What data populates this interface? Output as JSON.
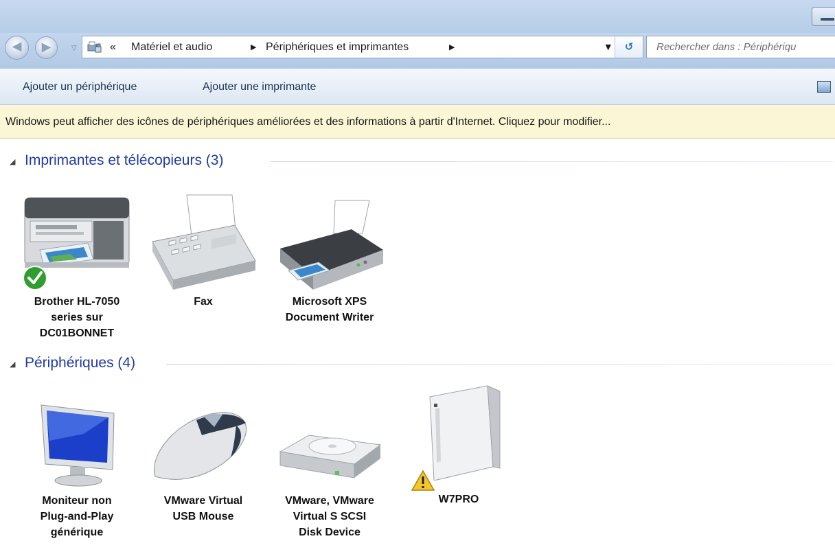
{
  "address_bar": {
    "overflow_chevron": "«",
    "crumbs": [
      "Matériel et audio",
      "Périphériques et imprimantes"
    ],
    "search_placeholder": "Rechercher dans : Périphériqu"
  },
  "command_bar": {
    "add_device": "Ajouter un périphérique",
    "add_printer": "Ajouter une imprimante"
  },
  "info_bar": {
    "text": "Windows peut afficher des icônes de périphériques améliorées et des informations à partir d'Internet. Cliquez pour modifier..."
  },
  "groups": [
    {
      "title": "Imprimantes et télécopieurs (3)",
      "items": [
        {
          "label": "Brother HL-7050\nseries sur\nDC01BONNET",
          "icon": "multifunction-printer-icon",
          "status": "default-check"
        },
        {
          "label": "Fax",
          "icon": "fax-icon"
        },
        {
          "label": "Microsoft XPS\nDocument Writer",
          "icon": "printer-icon"
        }
      ]
    },
    {
      "title": "Périphériques (4)",
      "items": [
        {
          "label": "Moniteur non\nPlug-and-Play\ngénérique",
          "icon": "monitor-icon"
        },
        {
          "label": "VMware Virtual\nUSB Mouse",
          "icon": "mouse-icon"
        },
        {
          "label": "VMware, VMware\nVirtual S SCSI\nDisk Device",
          "icon": "disk-drive-icon"
        },
        {
          "label": "W7PRO",
          "icon": "computer-tower-icon",
          "status": "warning"
        }
      ]
    }
  ],
  "colors": {
    "group_title": "#1e3aa6",
    "info_bar_bg": "#fbf6d6",
    "toolbar_bg": "#b6cde8"
  }
}
